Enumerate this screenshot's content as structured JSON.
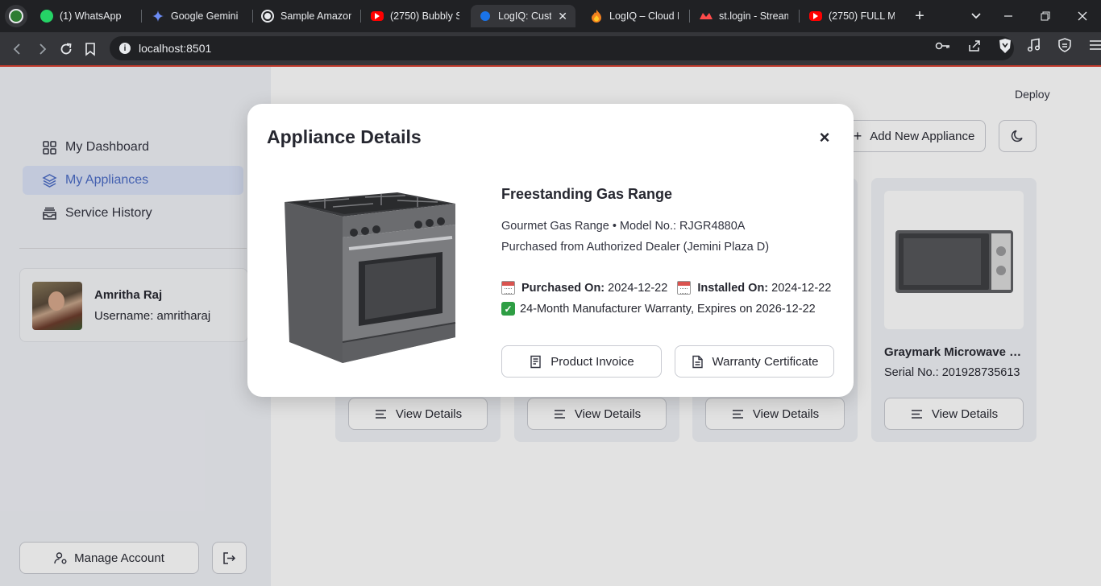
{
  "browser": {
    "tabs": [
      {
        "title": "(1) WhatsApp",
        "icon": "whatsapp-icon"
      },
      {
        "title": "Google Gemini",
        "icon": "gemini-icon"
      },
      {
        "title": "Sample Amazon",
        "icon": "openai-icon"
      },
      {
        "title": "(2750) Bubbly Si",
        "icon": "youtube-icon"
      },
      {
        "title": "LogIQ: Cust",
        "icon": "app-icon",
        "active": true
      },
      {
        "title": "LogIQ – Cloud F",
        "icon": "firebase-icon"
      },
      {
        "title": "st.login - Stream",
        "icon": "streamlit-icon"
      },
      {
        "title": "(2750) FULL MA",
        "icon": "youtube-icon"
      }
    ],
    "url": "localhost:8501"
  },
  "sidebar": {
    "items": [
      {
        "label": "My Dashboard",
        "icon": "grid-icon"
      },
      {
        "label": "My Appliances",
        "icon": "layers-icon",
        "active": true
      },
      {
        "label": "Service History",
        "icon": "inbox-stack-icon"
      }
    ],
    "profile": {
      "name": "Amritha Raj",
      "username": "Username: amritharaj"
    },
    "manage_account_label": "Manage Account"
  },
  "header": {
    "deploy_label": "Deploy",
    "add_appliance_label": "Add New Appliance"
  },
  "cards": [
    {
      "view_label": "View Details"
    },
    {
      "view_label": "View Details"
    },
    {
      "view_label": "View Details"
    },
    {
      "name": "Graymark Microwave …",
      "serial": "Serial No.: 201928735613",
      "view_label": "View Details"
    }
  ],
  "modal": {
    "title": "Appliance Details",
    "close_symbol": "×",
    "product_name": "Freestanding Gas Range",
    "model_line": "Gourmet Gas Range • Model No.: RJGR4880A",
    "purchase_line": "Purchased from Authorized Dealer (Jemini Plaza D)",
    "purchased_on_label": "Purchased On:",
    "purchased_on_value": "2024-12-22",
    "installed_on_label": "Installed On:",
    "installed_on_value": "2024-12-22",
    "warranty_text": "24-Month Manufacturer Warranty, Expires on 2026-12-22",
    "invoice_button": "Product Invoice",
    "certificate_button": "Warranty Certificate"
  }
}
